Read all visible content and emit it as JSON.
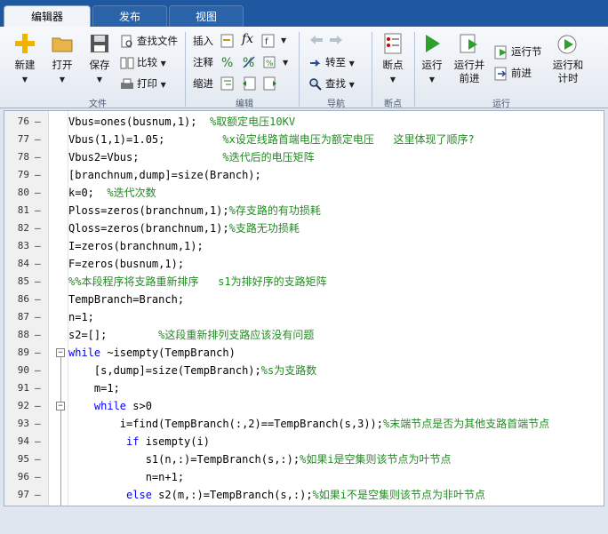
{
  "tabs": [
    {
      "label": "编辑器"
    },
    {
      "label": "发布"
    },
    {
      "label": "视图"
    }
  ],
  "ribbon": {
    "file": {
      "new": "新建",
      "open": "打开",
      "save": "保存",
      "find_files": "查找文件",
      "compare": "比较",
      "print": "打印",
      "group": "文件"
    },
    "edit": {
      "insert": "插入",
      "comment": "注释",
      "indent": "缩进",
      "fx": "fx",
      "group": "编辑"
    },
    "nav": {
      "goto": "转至",
      "find": "查找",
      "group": "导航"
    },
    "breakpoints": {
      "label": "断点",
      "group": "断点"
    },
    "run": {
      "run": "运行",
      "run_adv_1": "运行并",
      "run_adv_2": "前进",
      "run_section": "运行节",
      "advance": "前进",
      "run_time_1": "运行和",
      "run_time_2": "计时",
      "group": "运行"
    }
  },
  "editor": {
    "lines": [
      {
        "n": "76",
        "pre": "Vbus=ones(busnum,1);  ",
        "cm": "%取额定电压10KV"
      },
      {
        "n": "77",
        "pre": "Vbus(1,1)=1.05;         ",
        "cm": "%x设定线路首端电压为额定电压   这里体现了顺序?"
      },
      {
        "n": "78",
        "pre": "Vbus2=Vbus;             ",
        "cm": "%迭代后的电压矩阵"
      },
      {
        "n": "79",
        "pre": "[branchnum,dump]=size(Branch);",
        "cm": ""
      },
      {
        "n": "80",
        "pre": "k=0;  ",
        "cm": "%迭代次数"
      },
      {
        "n": "81",
        "pre": "Ploss=zeros(branchnum,1);",
        "cm": "%存支路的有功损耗"
      },
      {
        "n": "82",
        "pre": "Qloss=zeros(branchnum,1);",
        "cm": "%支路无功损耗"
      },
      {
        "n": "83",
        "pre": "I=zeros(branchnum,1);",
        "cm": ""
      },
      {
        "n": "84",
        "pre": "F=zeros(busnum,1);",
        "cm": ""
      },
      {
        "n": "85",
        "pre": "",
        "cm": "%%本段程序将支路重新排序   s1为排好序的支路矩阵"
      },
      {
        "n": "86",
        "pre": "TempBranch=Branch;",
        "cm": ""
      },
      {
        "n": "87",
        "pre": "n=1;",
        "cm": ""
      },
      {
        "n": "88",
        "pre": "s2=[];        ",
        "cm": "%这段重新排列支路应该没有问题"
      },
      {
        "n": "89",
        "kw": "while",
        "pre": " ~isempty(TempBranch)",
        "cm": ""
      },
      {
        "n": "90",
        "pre": "    [s,dump]=size(TempBranch);",
        "cm": "%s为支路数"
      },
      {
        "n": "91",
        "pre": "    m=1;",
        "cm": ""
      },
      {
        "n": "92",
        "kw": "    while",
        "pre": " s>0",
        "cm": ""
      },
      {
        "n": "93",
        "pre": "        i=find(TempBranch(:,2)==TempBranch(s,3));",
        "cm": "%末端节点是否为其他支路首端节点"
      },
      {
        "n": "94",
        "kw": "         if",
        "pre": " isempty(i)",
        "cm": ""
      },
      {
        "n": "95",
        "pre": "            s1(n,:)=TempBranch(s,:);",
        "cm": "%如果i是空集则该节点为叶节点"
      },
      {
        "n": "96",
        "pre": "            n=n+1;",
        "cm": ""
      },
      {
        "n": "97",
        "kw": "         else",
        "pre": " s2(m,:)=TempBranch(s,:);",
        "cm": "%如果i不是空集则该节点为非叶节点"
      }
    ]
  }
}
